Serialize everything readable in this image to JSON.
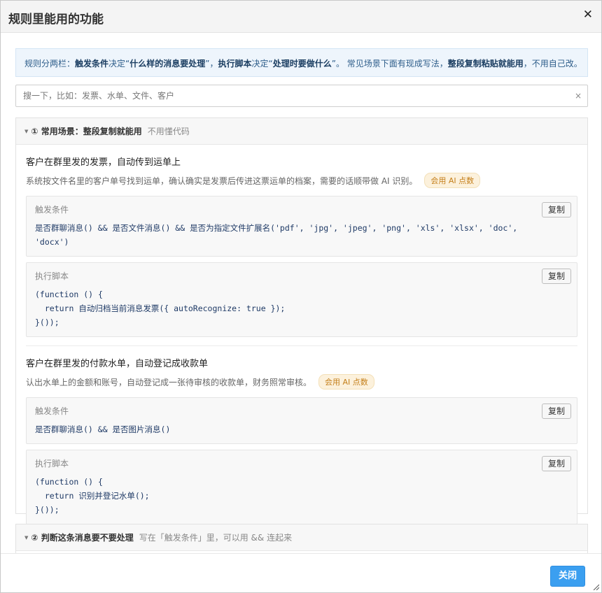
{
  "dialog": {
    "title": "规则里能用的功能",
    "close_label": "关闭"
  },
  "info": {
    "p1": "规则分两栏：",
    "b1": "触发条件",
    "p2": "决定“",
    "b2": "什么样的消息要处理",
    "p3": "”，",
    "b3": "执行脚本",
    "p4": "决定“",
    "b4": "处理时要做什么",
    "p5": "”。 常见场景下面有现成写法，",
    "b5": "整段复制粘贴就能用",
    "p6": "，不用自己改。"
  },
  "search": {
    "placeholder": "搜一下，比如：发票、水单、文件、客户",
    "value": ""
  },
  "section1": {
    "title": "① 常用场景：整段复制就能用",
    "subtitle": "不用懂代码",
    "items": [
      {
        "title": "客户在群里发的发票，自动传到运单上",
        "desc": "系统按文件名里的客户单号找到运单，确认确实是发票后传进这票运单的档案，需要的话顺带做 AI 识别。",
        "badge": "会用 AI 点数",
        "trigger_label": "触发条件",
        "trigger_code": "是否群聊消息() && 是否文件消息() && 是否为指定文件扩展名('pdf', 'jpg', 'jpeg', 'png', 'xls', 'xlsx', 'doc', 'docx')",
        "script_label": "执行脚本",
        "script_code": "(function () {\n  return 自动归档当前消息发票({ autoRecognize: true });\n}());"
      },
      {
        "title": "客户在群里发的付款水单，自动登记成收款单",
        "desc": "认出水单上的金额和账号，自动登记成一张待审核的收款单，财务照常审核。",
        "badge": "会用 AI 点数",
        "trigger_label": "触发条件",
        "trigger_code": "是否群聊消息() && 是否图片消息()",
        "script_label": "执行脚本",
        "script_code": "(function () {\n  return 识别并登记水单();\n}());"
      }
    ],
    "copy_label": "复制"
  },
  "section2": {
    "title": "② 判断这条消息要不要处理",
    "subtitle": "写在「触发条件」里，可以用 && 连起来"
  }
}
